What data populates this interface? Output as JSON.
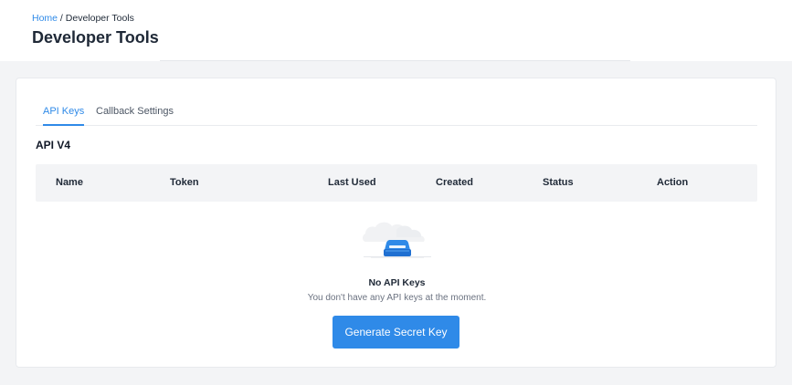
{
  "breadcrumb": {
    "home": "Home",
    "separator": " / ",
    "current": "Developer Tools"
  },
  "page": {
    "title": "Developer Tools"
  },
  "tabs": [
    {
      "label": "API Keys",
      "active": true
    },
    {
      "label": "Callback Settings",
      "active": false
    }
  ],
  "section": {
    "title": "API V4"
  },
  "table": {
    "columns": [
      "Name",
      "Token",
      "Last Used",
      "Created",
      "Status",
      "Action"
    ],
    "rows": []
  },
  "empty_state": {
    "icon": "empty-box-icon",
    "title": "No API Keys",
    "message": "You don't have any API keys at the moment."
  },
  "actions": {
    "generate_label": "Generate Secret Key"
  },
  "colors": {
    "accent": "#2f8ae8",
    "page_background": "#f3f4f6",
    "table_header_background": "#f3f4f6"
  }
}
